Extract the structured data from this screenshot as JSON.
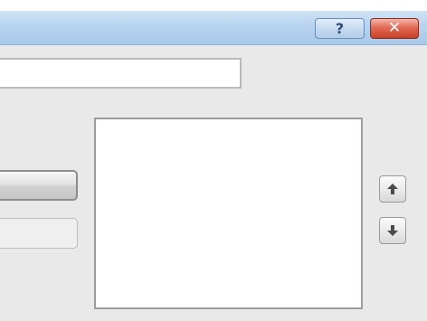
{
  "window": {
    "title_bar_buttons": [
      {
        "name": "help",
        "label": "?"
      },
      {
        "name": "close",
        "label": "✕"
      }
    ]
  },
  "main": {
    "text_field": {
      "value": "",
      "placeholder": ""
    },
    "left_buttons": [
      {
        "label": ""
      },
      {
        "label": ""
      }
    ],
    "list_box": {
      "items": []
    },
    "reorder_buttons": {
      "up_icon": "arrow-up-icon",
      "down_icon": "arrow-down-icon"
    }
  },
  "colors": {
    "title_bar": "#b7d3ee",
    "close_button": "#e16a55",
    "window_background": "#e9e9e9"
  }
}
